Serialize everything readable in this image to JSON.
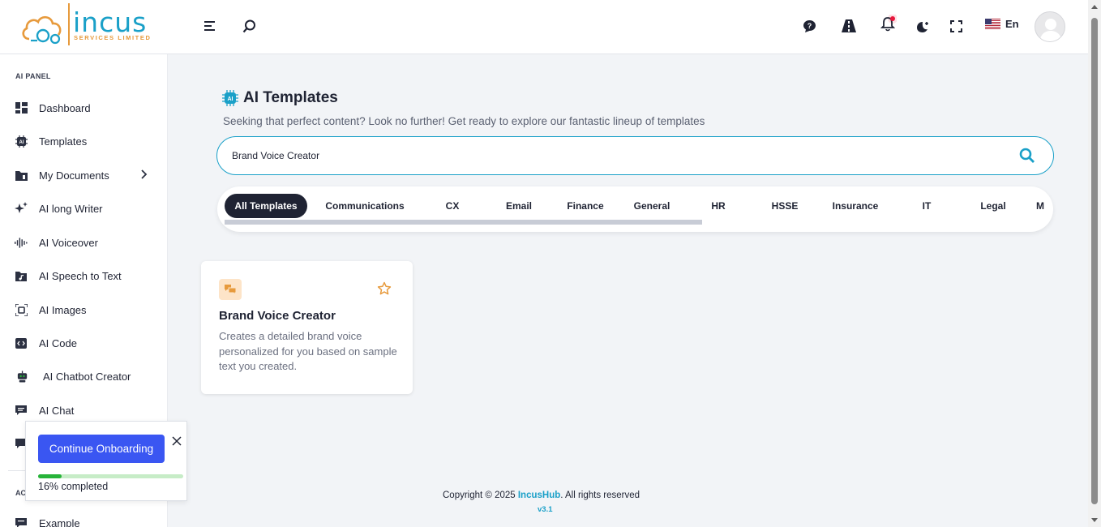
{
  "brand": {
    "name": "incus",
    "tagline": "SERVICES LIMITED"
  },
  "header": {
    "icons": [
      "menu-icon",
      "search-icon",
      "chat-help-icon",
      "road-icon",
      "bell-icon",
      "moon-icon",
      "fullscreen-icon"
    ],
    "language": "En"
  },
  "sidebar": {
    "panel_title": "AI PANEL",
    "items": [
      {
        "label": "Dashboard",
        "icon": "dashboard-icon"
      },
      {
        "label": "Templates",
        "icon": "ai-chip-icon"
      },
      {
        "label": "My Documents",
        "icon": "folder-icon"
      },
      {
        "label": "AI long Writer",
        "icon": "sparkles-icon"
      },
      {
        "label": "AI Voiceover",
        "icon": "waveform-icon"
      },
      {
        "label": "AI Speech to Text",
        "icon": "audio-file-icon"
      },
      {
        "label": "AI Images",
        "icon": "image-scan-icon"
      },
      {
        "label": "AI Code",
        "icon": "code-icon"
      },
      {
        "label": "AI Chatbot Creator",
        "icon": "robot-icon"
      },
      {
        "label": "AI Chat",
        "icon": "chat-icon"
      }
    ],
    "section_2_title": "AC",
    "extra_item": "Example"
  },
  "main": {
    "title": "AI Templates",
    "subtitle": "Seeking that perfect content? Look no further! Get ready to explore our fantastic lineup of templates",
    "search_value": "Brand Voice Creator",
    "tabs": [
      "All Templates",
      "Communications",
      "CX",
      "Email",
      "Finance",
      "General",
      "HR",
      "HSSE",
      "Insurance",
      "IT",
      "Legal",
      "M"
    ],
    "active_tab": "All Templates",
    "cards": [
      {
        "title": "Brand Voice Creator",
        "description": "Creates a detailed brand voice personalized for you based on sample text you created."
      }
    ]
  },
  "footer": {
    "copyright_prefix": "Copyright © 2025 ",
    "company": "IncusHub",
    "suffix": ". All rights reserved",
    "version": "v3.1"
  },
  "onboarding": {
    "button": "Continue Onboarding",
    "progress_text": "16% completed",
    "progress": 0.16
  },
  "colors": {
    "accent": "#1aa0c8",
    "primary_button": "#3a56f2",
    "logo_orange": "#e79a3c",
    "progress": "#27b339"
  }
}
